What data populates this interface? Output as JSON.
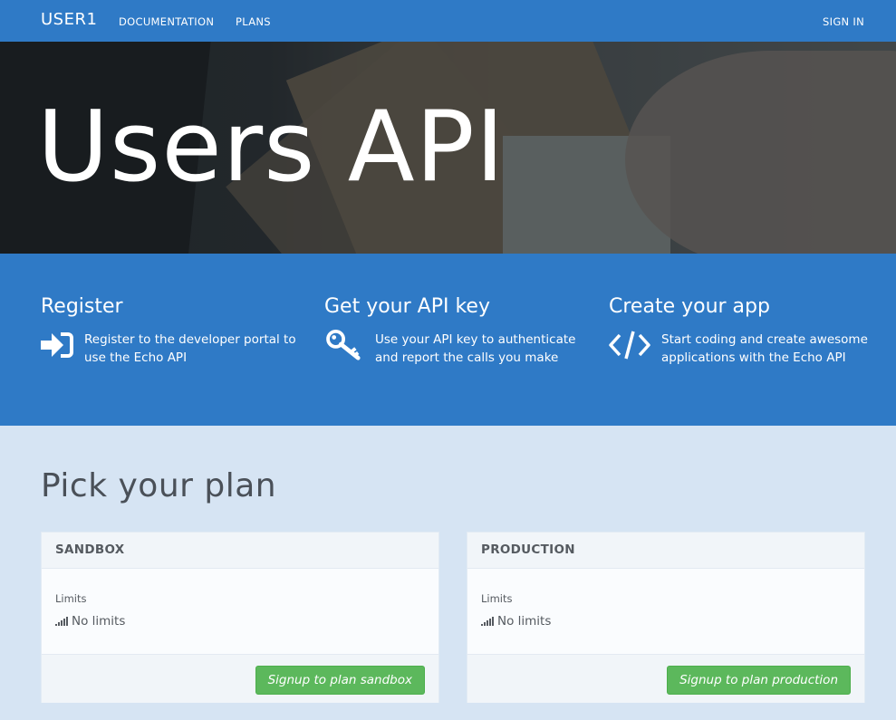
{
  "navbar": {
    "brand": "USER1",
    "links": [
      "DOCUMENTATION",
      "PLANS"
    ],
    "signin": "SIGN IN"
  },
  "hero": {
    "title": "Users API"
  },
  "steps": [
    {
      "title": "Register",
      "text": "Register to the developer portal to use the Echo API",
      "icon": "sign-in-icon"
    },
    {
      "title": "Get your API key",
      "text": "Use your API key to authenticate and report the calls you make",
      "icon": "key-icon"
    },
    {
      "title": "Create your app",
      "text": "Start coding and create awesome applications with the Echo API",
      "icon": "code-icon"
    }
  ],
  "plans": {
    "title": "Pick your plan",
    "items": [
      {
        "name": "SANDBOX",
        "limits_label": "Limits",
        "limit": "No limits",
        "button": "Signup to plan sandbox"
      },
      {
        "name": "PRODUCTION",
        "limits_label": "Limits",
        "limit": "No limits",
        "button": "Signup to plan production"
      }
    ]
  },
  "colors": {
    "primary": "#2f7ac6",
    "page_bg": "#d6e4f3",
    "success": "#5cb85c",
    "heading_text": "#4a5058"
  }
}
